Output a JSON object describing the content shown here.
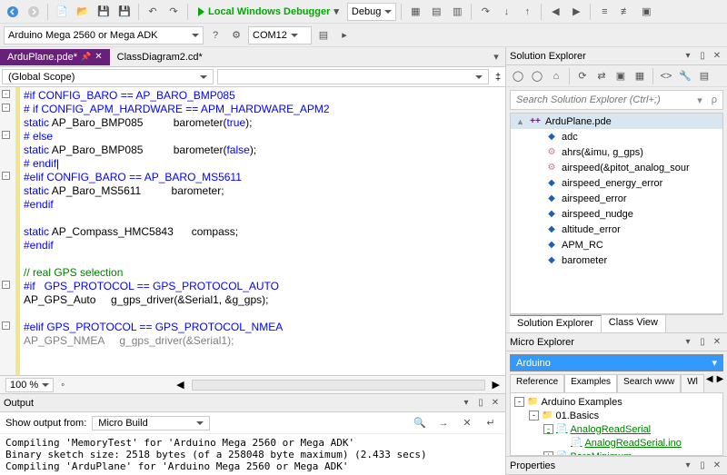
{
  "toolbar": {
    "debugger_label": "Local Windows Debugger",
    "config": "Debug",
    "board": "Arduino Mega 2560 or Mega ADK",
    "port": "COM12"
  },
  "editor": {
    "tabs": [
      {
        "name": "ArduPlane.pde*",
        "active": true
      },
      {
        "name": "ClassDiagram2.cd*",
        "active": false
      }
    ],
    "scope": "(Global Scope)",
    "zoom": "100 %",
    "code": [
      {
        "o": "m",
        "t": "#if CONFIG_BARO == AP_BARO_BMP085",
        "c": "blue"
      },
      {
        "o": "m",
        "t": "# if CONFIG_APM_HARDWARE == APM_HARDWARE_APM2",
        "c": "blue"
      },
      {
        "o": "",
        "parts": [
          {
            "t": "static",
            "c": "blue"
          },
          {
            "t": " AP_Baro_BMP085          barometer(",
            "c": "dark"
          },
          {
            "t": "true",
            "c": "blue"
          },
          {
            "t": ");",
            "c": "dark"
          }
        ]
      },
      {
        "o": "m",
        "t": "# else",
        "c": "blue"
      },
      {
        "o": "",
        "parts": [
          {
            "t": "static",
            "c": "blue"
          },
          {
            "t": " AP_Baro_BMP085          barometer(",
            "c": "dark"
          },
          {
            "t": "false",
            "c": "blue"
          },
          {
            "t": ");",
            "c": "dark"
          }
        ]
      },
      {
        "o": "",
        "t": "# endif",
        "c": "blue",
        "cursor": true
      },
      {
        "o": "m",
        "t": "#elif CONFIG_BARO == AP_BARO_MS5611",
        "c": "blue"
      },
      {
        "o": "",
        "parts": [
          {
            "t": "static",
            "c": "blue"
          },
          {
            "t": " AP_Baro_MS5611          barometer;",
            "c": "dark"
          }
        ]
      },
      {
        "o": "",
        "t": "#endif",
        "c": "blue"
      },
      {
        "o": "",
        "t": "",
        "c": "dark"
      },
      {
        "o": "",
        "parts": [
          {
            "t": "static",
            "c": "blue"
          },
          {
            "t": " AP_Compass_HMC5843      compass;",
            "c": "dark"
          }
        ]
      },
      {
        "o": "",
        "t": "#endif",
        "c": "blue"
      },
      {
        "o": "",
        "t": "",
        "c": "dark"
      },
      {
        "o": "",
        "t": "// real GPS selection",
        "c": "green"
      },
      {
        "o": "m",
        "t": "#if   GPS_PROTOCOL == GPS_PROTOCOL_AUTO",
        "c": "blue"
      },
      {
        "o": "",
        "parts": [
          {
            "t": "AP_GPS_Auto     g_gps_driver(&Serial1, &g_gps);",
            "c": "dark"
          }
        ]
      },
      {
        "o": "",
        "t": "",
        "c": "dark"
      },
      {
        "o": "m",
        "t": "#elif GPS_PROTOCOL == GPS_PROTOCOL_NMEA",
        "c": "blue"
      },
      {
        "o": "",
        "parts": [
          {
            "t": "AP_GPS_NMEA     g_gps_driver(&Serial1);",
            "c": "gray"
          }
        ]
      }
    ]
  },
  "output": {
    "title": "Output",
    "from_label": "Show output from:",
    "from_value": "Micro Build",
    "lines": [
      "Compiling 'MemoryTest' for 'Arduino Mega 2560 or Mega ADK'",
      "Binary sketch size: 2518 bytes (of a 258048 byte maximum) (2.433 secs)",
      "Compiling 'ArduPlane' for 'Arduino Mega 2560 or Mega ADK'"
    ]
  },
  "solution_explorer": {
    "title": "Solution Explorer",
    "search_placeholder": "Search Solution Explorer (Ctrl+;)",
    "items": [
      {
        "icon": "cpp",
        "label": "ArduPlane.pde",
        "indent": 0,
        "sel": true,
        "tog": "▲"
      },
      {
        "icon": "field",
        "label": "adc",
        "indent": 1
      },
      {
        "icon": "method",
        "label": "ahrs(&imu, g_gps)",
        "indent": 1
      },
      {
        "icon": "method",
        "label": "airspeed(&pitot_analog_sour",
        "indent": 1
      },
      {
        "icon": "field",
        "label": "airspeed_energy_error",
        "indent": 1
      },
      {
        "icon": "field",
        "label": "airspeed_error",
        "indent": 1
      },
      {
        "icon": "field",
        "label": "airspeed_nudge",
        "indent": 1
      },
      {
        "icon": "field",
        "label": "altitude_error",
        "indent": 1
      },
      {
        "icon": "field",
        "label": "APM_RC",
        "indent": 1
      },
      {
        "icon": "field",
        "label": "barometer",
        "indent": 1
      }
    ],
    "tabs": [
      "Solution Explorer",
      "Class View"
    ]
  },
  "micro_explorer": {
    "title": "Micro Explorer",
    "selected": "Arduino",
    "tabs": [
      "Reference",
      "Examples",
      "Search www",
      "Wl"
    ],
    "active_tab": 1,
    "tree": [
      {
        "indent": 0,
        "tog": "-",
        "label": "Arduino Examples"
      },
      {
        "indent": 1,
        "tog": "-",
        "label": "01.Basics"
      },
      {
        "indent": 2,
        "tog": "-",
        "label": "AnalogReadSerial",
        "link": true
      },
      {
        "indent": 3,
        "tog": "",
        "label": "AnalogReadSerial.ino",
        "link": true
      },
      {
        "indent": 2,
        "tog": "+",
        "label": "BareMinimum",
        "link": true
      }
    ]
  },
  "properties": {
    "title": "Properties"
  }
}
